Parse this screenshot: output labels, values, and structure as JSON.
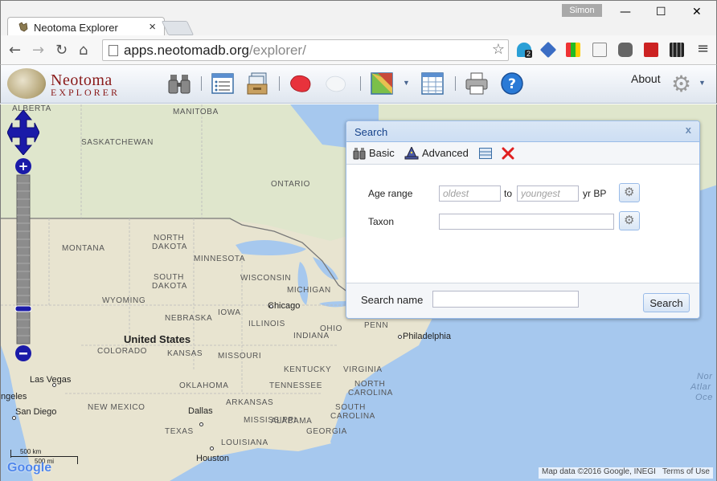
{
  "browser": {
    "tab_title": "Neotoma Explorer",
    "tab_close": "×",
    "profile_name": "Simon",
    "url_host": "apps.neotomadb.org",
    "url_path": "/explorer/",
    "window_minimize": "—",
    "window_maximize": "☐",
    "window_close": "✕",
    "ext_badge": "2"
  },
  "app": {
    "logo_line1": "Neotoma",
    "logo_line2": "EXPLORER",
    "about_label": "About"
  },
  "map": {
    "labels": {
      "alberta": "ALBERTA",
      "manitoba": "MANITOBA",
      "saskatchewan": "SASKATCHEWAN",
      "ontario": "ONTARIO",
      "north_dakota_1": "NORTH",
      "north_dakota_2": "DAKOTA",
      "montana": "MONTANA",
      "minnesota": "MINNESOTA",
      "south_dakota_1": "SOUTH",
      "south_dakota_2": "DAKOTA",
      "wisconsin": "WISCONSIN",
      "michigan": "MICHIGAN",
      "wyoming": "WYOMING",
      "nebraska": "NEBRASKA",
      "iowa": "IOWA",
      "illinois": "ILLINOIS",
      "ohio": "OHIO",
      "indiana": "INDIANA",
      "penn": "PENN",
      "united_states": "United States",
      "colorado": "COLORADO",
      "kansas": "KANSAS",
      "missouri": "MISSOURI",
      "kentucky": "KENTUCKY",
      "virginia": "VIRGINIA",
      "tennessee": "TENNESSEE",
      "oklahoma": "OKLAHOMA",
      "arkansas": "ARKANSAS",
      "north_carolina_1": "NORTH",
      "north_carolina_2": "CAROLINA",
      "south_carolina_1": "SOUTH",
      "south_carolina_2": "CAROLINA",
      "new_mexico": "NEW MEXICO",
      "mississippi": "MISSISSIPPI",
      "alabama": "ALABAMA",
      "georgia": "GEORGIA",
      "texas": "TEXAS",
      "louisiana": "LOUISIANA",
      "chicago": "Chicago",
      "philadelphia": "Philadelphia",
      "las_vegas": "Las Vegas",
      "angeles": "ngeles",
      "san_diego": "San Diego",
      "dallas": "Dallas",
      "houston": "Houston",
      "atlantic_1": "Nor",
      "atlantic_2": "Atlar",
      "atlantic_3": "Oce"
    },
    "scale_km": "500 km",
    "scale_mi": "500 mi",
    "google_logo": "Google",
    "attribution": "Map data ©2016 Google, INEGI",
    "terms": "Terms of Use"
  },
  "search_dialog": {
    "title": "Search",
    "close": "x",
    "tab_basic": "Basic",
    "tab_advanced": "Advanced",
    "age_range_label": "Age range",
    "age_oldest_placeholder": "oldest",
    "age_to": "to",
    "age_youngest_placeholder": "youngest",
    "age_unit": "yr BP",
    "taxon_label": "Taxon",
    "taxon_value": "",
    "search_name_label": "Search name",
    "search_name_value": "",
    "search_button": "Search"
  },
  "colors": {
    "dialog_header": "#cddef3",
    "dialog_title": "#15428b",
    "logo_text": "#8a1a1a",
    "map_land": "#e8e4d0",
    "map_water": "#a6c8ee"
  }
}
